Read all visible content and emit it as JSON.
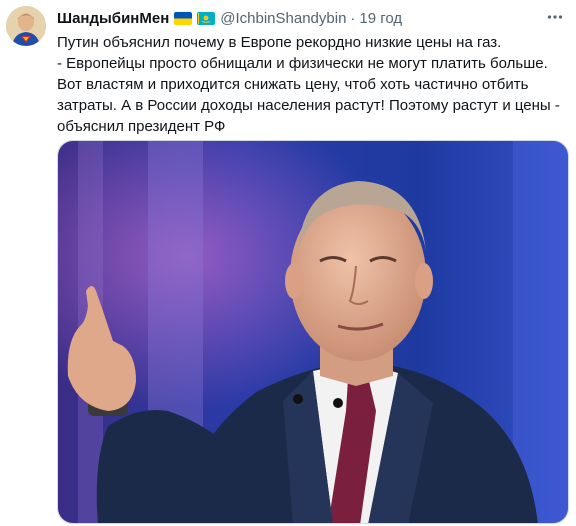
{
  "tweet": {
    "display_name": "ШандыбинМен",
    "handle": "@IchbinShandybin",
    "separator": "·",
    "time": "19 год",
    "text_lines": [
      "Путин объяснил почему в Европе рекордно низкие цены на газ.",
      "- Европейцы просто обнищали и физически не могут платить больше.",
      "Вот властям и приходится снижать цену, чтоб хоть частично отбить",
      "затраты. А в России доходы населения растут! Поэтому растут и цены -",
      "объяснил президент РФ"
    ]
  },
  "icons": {
    "flag_1": "ukraine-flag-icon",
    "flag_2": "kazakhstan-flag-icon",
    "more": "more-options-icon"
  },
  "colors": {
    "text": "#0f1419",
    "secondary": "#536471",
    "flag_blue": "#0057b7",
    "flag_yellow": "#ffd700",
    "kz_blue": "#00afca"
  }
}
